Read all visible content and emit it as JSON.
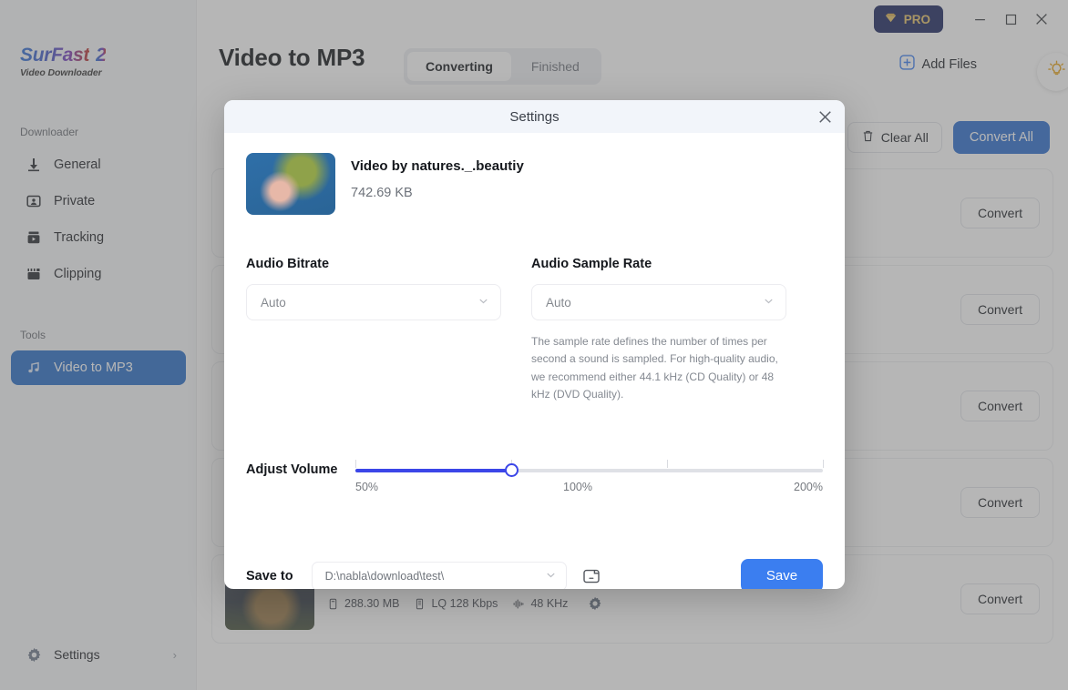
{
  "sidebar": {
    "logo": {
      "line1": "SurFast",
      "mark": "2",
      "line2": "Video Downloader"
    },
    "section_downloader": "Downloader",
    "section_tools": "Tools",
    "downloader_items": [
      {
        "label": "General",
        "icon": "download-arrow-icon"
      },
      {
        "label": "Private",
        "icon": "private-user-icon"
      },
      {
        "label": "Tracking",
        "icon": "tracking-video-icon"
      },
      {
        "label": "Clipping",
        "icon": "clipping-film-icon"
      }
    ],
    "tools_items": [
      {
        "label": "Video to MP3",
        "icon": "music-note-icon",
        "active": true
      }
    ],
    "settings": {
      "label": "Settings",
      "icon": "gear-icon",
      "chevron": "chevron-right-icon"
    }
  },
  "titlebar": {
    "pro_label": "PRO",
    "minimize": "minimize-icon",
    "maximize": "maximize-icon",
    "close": "close-icon"
  },
  "header": {
    "title": "Video to MP3",
    "tabs": [
      {
        "label": "Converting",
        "active": true
      },
      {
        "label": "Finished",
        "active": false
      }
    ],
    "add_files_label": "Add Files",
    "tip_icon": "lightbulb-icon"
  },
  "toolbar": {
    "clear_all_label": "Clear All",
    "convert_all_label": "Convert All"
  },
  "file_list": {
    "convert_label": "Convert",
    "rows": [
      {
        "name": "",
        "size": "",
        "bitrate": "",
        "samplerate": "",
        "thumb": "a"
      },
      {
        "name": "",
        "size": "",
        "bitrate": "",
        "samplerate": "",
        "thumb": "a"
      },
      {
        "name": "",
        "size": "",
        "bitrate": "",
        "samplerate": "",
        "thumb": "a"
      },
      {
        "name": "",
        "size": "",
        "bitrate": "",
        "samplerate": "",
        "thumb": "a"
      },
      {
        "name": "",
        "size": "288.30 MB",
        "bitrate": "LQ 128 Kbps",
        "samplerate": "48 KHz",
        "thumb": "b"
      }
    ]
  },
  "modal": {
    "title": "Settings",
    "close_icon": "close-icon",
    "file": {
      "name": "Video by natures._.beautiy",
      "size": "742.69 KB"
    },
    "audio_bitrate": {
      "label": "Audio Bitrate",
      "value": "Auto"
    },
    "audio_sample_rate": {
      "label": "Audio Sample Rate",
      "value": "Auto",
      "hint": "The sample rate defines the number of times per second a sound is sampled. For high-quality audio, we recommend either 44.1 kHz (CD Quality) or 48 kHz (DVD Quality)."
    },
    "volume": {
      "label": "Adjust Volume",
      "min_label": "50%",
      "mid_label": "100%",
      "max_label": "200%",
      "value": 100,
      "min": 50,
      "max": 200
    },
    "save_to": {
      "label": "Save to",
      "path": "D:\\nabla\\download\\test\\",
      "folder_icon": "folder-icon"
    },
    "save_button": "Save"
  },
  "colors": {
    "accent_blue": "#3b7ef0",
    "primary_blue": "#2f6fd0",
    "slider_blue": "#3b46e8",
    "sidebar_active": "#2b6fc7",
    "pro_navy": "#1f2a63",
    "pro_gold": "#e8c46a"
  }
}
